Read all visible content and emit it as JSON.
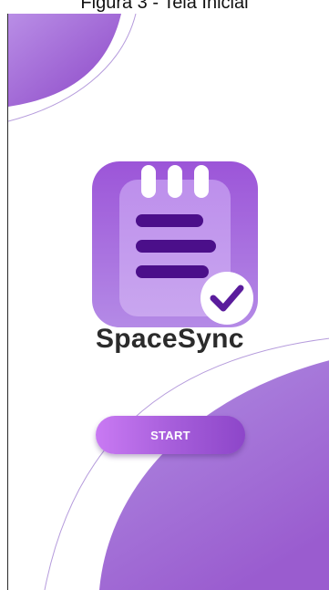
{
  "caption": "Figura 3 - Tela Inicial",
  "app": {
    "name": "SpaceSync",
    "logo_icon": "notepad-checkmark-icon"
  },
  "start_button": {
    "label": "START"
  },
  "colors": {
    "accent_light": "#c97af3",
    "accent": "#a45cd9",
    "accent_dark": "#8d46c9",
    "icon_lines": "#4b0f8a",
    "title": "#2b2b2b"
  }
}
